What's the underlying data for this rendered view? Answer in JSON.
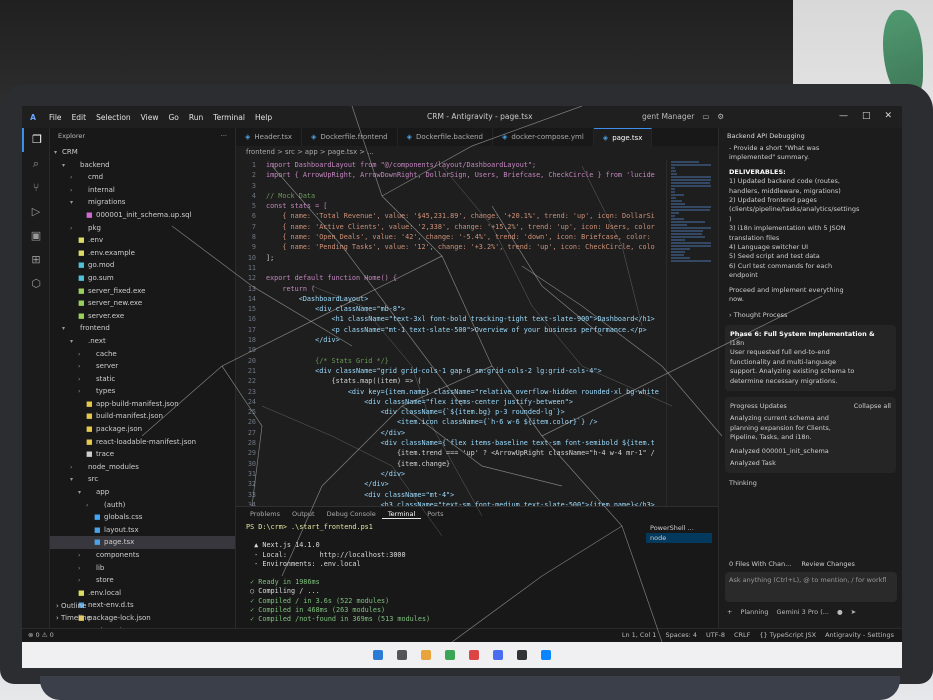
{
  "window": {
    "menu": [
      "File",
      "Edit",
      "Selection",
      "View",
      "Go",
      "Run",
      "Terminal",
      "Help"
    ],
    "title": "CRM - Antigravity - page.tsx",
    "agent_manager": "gent Manager"
  },
  "explorer": {
    "header": "Explorer",
    "root": "CRM",
    "items": [
      {
        "label": "backend",
        "type": "folder",
        "depth": 1,
        "open": true
      },
      {
        "label": "cmd",
        "type": "folder",
        "depth": 2
      },
      {
        "label": "internal",
        "type": "folder",
        "depth": 2
      },
      {
        "label": "migrations",
        "type": "folder",
        "depth": 2,
        "open": true
      },
      {
        "label": "000001_init_schema.up.sql",
        "type": "sql",
        "depth": 3
      },
      {
        "label": "pkg",
        "type": "folder",
        "depth": 2
      },
      {
        "label": ".env",
        "type": "env",
        "depth": 2
      },
      {
        "label": ".env.example",
        "type": "env",
        "depth": 2
      },
      {
        "label": "go.mod",
        "type": "go",
        "depth": 2
      },
      {
        "label": "go.sum",
        "type": "go",
        "depth": 2
      },
      {
        "label": "server_fixed.exe",
        "type": "exe",
        "depth": 2
      },
      {
        "label": "server_new.exe",
        "type": "exe",
        "depth": 2
      },
      {
        "label": "server.exe",
        "type": "exe",
        "depth": 2
      },
      {
        "label": "frontend",
        "type": "folder",
        "depth": 1,
        "open": true
      },
      {
        "label": ".next",
        "type": "folder",
        "depth": 2,
        "open": true
      },
      {
        "label": "cache",
        "type": "folder",
        "depth": 3
      },
      {
        "label": "server",
        "type": "folder",
        "depth": 3
      },
      {
        "label": "static",
        "type": "folder",
        "depth": 3
      },
      {
        "label": "types",
        "type": "folder",
        "depth": 3
      },
      {
        "label": "app-build-manifest.json",
        "type": "json",
        "depth": 3
      },
      {
        "label": "build-manifest.json",
        "type": "json",
        "depth": 3
      },
      {
        "label": "package.json",
        "type": "json",
        "depth": 3
      },
      {
        "label": "react-loadable-manifest.json",
        "type": "json",
        "depth": 3
      },
      {
        "label": "trace",
        "type": "file",
        "depth": 3
      },
      {
        "label": "node_modules",
        "type": "folder",
        "depth": 2
      },
      {
        "label": "src",
        "type": "folder",
        "depth": 2,
        "open": true
      },
      {
        "label": "app",
        "type": "folder",
        "depth": 3,
        "open": true
      },
      {
        "label": "(auth)",
        "type": "folder",
        "depth": 4
      },
      {
        "label": "globals.css",
        "type": "css",
        "depth": 4
      },
      {
        "label": "layout.tsx",
        "type": "ts",
        "depth": 4
      },
      {
        "label": "page.tsx",
        "type": "ts",
        "depth": 4,
        "selected": true
      },
      {
        "label": "components",
        "type": "folder",
        "depth": 3
      },
      {
        "label": "lib",
        "type": "folder",
        "depth": 3
      },
      {
        "label": "store",
        "type": "folder",
        "depth": 3
      },
      {
        "label": ".env.local",
        "type": "env",
        "depth": 2
      },
      {
        "label": "next-env.d.ts",
        "type": "ts",
        "depth": 2
      },
      {
        "label": "package-lock.json",
        "type": "json",
        "depth": 2
      },
      {
        "label": "package.json",
        "type": "json",
        "depth": 2
      }
    ],
    "outline": "Outline",
    "timeline": "Timeline"
  },
  "tabs": [
    {
      "label": "Header.tsx",
      "active": false
    },
    {
      "label": "Dockerfile.frontend",
      "active": false
    },
    {
      "label": "Dockerfile.backend",
      "active": false
    },
    {
      "label": "docker-compose.yml",
      "active": false
    },
    {
      "label": "page.tsx",
      "active": true
    }
  ],
  "breadcrumb": "frontend > src > app > page.tsx > ...",
  "code_lines": [
    {
      "n": "1",
      "t": "import DashboardLayout from \"@/components/layout/DashboardLayout\";"
    },
    {
      "n": "2",
      "t": "import { ArrowUpRight, ArrowDownRight, DollarSign, Users, Briefcase, CheckCircle } from 'lucide"
    },
    {
      "n": "3",
      "t": ""
    },
    {
      "n": "4",
      "t": "// Mock Data"
    },
    {
      "n": "5",
      "t": "const stats = ["
    },
    {
      "n": "6",
      "t": "    { name: 'Total Revenue', value: '$45,231.89', change: '+20.1%', trend: 'up', icon: DollarSi"
    },
    {
      "n": "7",
      "t": "    { name: 'Active Clients', value: '2,338', change: '+15.2%', trend: 'up', icon: Users, color"
    },
    {
      "n": "8",
      "t": "    { name: 'Open Deals', value: '42', change: '-5.4%', trend: 'down', icon: Briefcase, color:"
    },
    {
      "n": "9",
      "t": "    { name: 'Pending Tasks', value: '12', change: '+3.2%', trend: 'up', icon: CheckCircle, colo"
    },
    {
      "n": "10",
      "t": "];"
    },
    {
      "n": "11",
      "t": ""
    },
    {
      "n": "12",
      "t": "export default function Home() {"
    },
    {
      "n": "13",
      "t": "    return ("
    },
    {
      "n": "14",
      "t": "        <DashboardLayout>"
    },
    {
      "n": "15",
      "t": "            <div className=\"mb-8\">"
    },
    {
      "n": "16",
      "t": "                <h1 className=\"text-3xl font-bold tracking-tight text-slate-900\">Dashboard</h1>"
    },
    {
      "n": "17",
      "t": "                <p className=\"mt-1 text-slate-500\">Overview of your business performance.</p>"
    },
    {
      "n": "18",
      "t": "            </div>"
    },
    {
      "n": "19",
      "t": ""
    },
    {
      "n": "20",
      "t": "            {/* Stats Grid */}"
    },
    {
      "n": "21",
      "t": "            <div className=\"grid grid-cols-1 gap-6 sm:grid-cols-2 lg:grid-cols-4\">"
    },
    {
      "n": "22",
      "t": "                {stats.map((item) => ("
    },
    {
      "n": "23",
      "t": "                    <div key={item.name} className=\"relative overflow-hidden rounded-xl bg-white"
    },
    {
      "n": "24",
      "t": "                        <div className=\"flex items-center justify-between\">"
    },
    {
      "n": "25",
      "t": "                            <div className={`${item.bg} p-3 rounded-lg`}>"
    },
    {
      "n": "26",
      "t": "                                <item.icon className={`h-6 w-6 ${item.color}`} />"
    },
    {
      "n": "27",
      "t": "                            </div>"
    },
    {
      "n": "28",
      "t": "                            <div className={`flex items-baseline text-sm font-semibold ${item.t"
    },
    {
      "n": "29",
      "t": "                                {item.trend === 'up' ? <ArrowUpRight className=\"h-4 w-4 mr-1\" /"
    },
    {
      "n": "30",
      "t": "                                {item.change}"
    },
    {
      "n": "31",
      "t": "                            </div>"
    },
    {
      "n": "32",
      "t": "                        </div>"
    },
    {
      "n": "33",
      "t": "                        <div className=\"mt-4\">"
    },
    {
      "n": "34",
      "t": "                            <h3 className=\"text-sm font-medium text-slate-500\">{item.name}</h3>"
    }
  ],
  "panel": {
    "tabs": [
      "Problems",
      "Output",
      "Debug Console",
      "Terminal",
      "Ports"
    ],
    "active_tab": "Terminal",
    "terminal_lines": [
      "PS D:\\crm> .\\start_frontend.ps1",
      "",
      "  ▲ Next.js 14.1.0",
      "  - Local:        http://localhost:3000",
      "  - Environments: .env.local",
      "",
      " ✓ Ready in 1986ms",
      " ○ Compiling / ...",
      " ✓ Compiled / in 3.6s (522 modules)",
      " ✓ Compiled in 468ms (263 modules)",
      " ✓ Compiled /not-found in 369ms (513 modules)"
    ],
    "terminals": [
      "PowerShell ...",
      "node"
    ]
  },
  "chat": {
    "title": "Backend API Debugging",
    "lines": [
      "- Provide a short \"What was",
      "implemented\" summary.",
      "",
      "DELIVERABLES:",
      "1) Updated backend code (routes,",
      "handlers, middleware, migrations)",
      "2) Updated frontend pages",
      "(clients/pipeline/tasks/analytics/settings",
      ")",
      "3) i18n implementation with 5 JSON",
      "translation files",
      "4) Language switcher UI",
      "5) Seed script and test data",
      "6) Curl test commands for each",
      "endpoint",
      "",
      "Proceed and implement everything",
      "now."
    ],
    "thought": "Thought Process",
    "phase_title": "Phase 6: Full System Implementation &",
    "phase_lines": [
      "i18n",
      "User requested full end-to-end",
      "functionality and multi-language",
      "support. Analyzing existing schema to",
      "determine necessary migrations."
    ],
    "progress_label": "Progress Updates",
    "collapse_label": "Collapse all",
    "progress_lines": [
      "Analyzing current schema and",
      "planning expansion for Clients,",
      "Pipeline, Tasks, and i18n."
    ],
    "analyzed_1": "Analyzed  000001_init_schema",
    "analyzed_2": "Analyzed  Task",
    "thinking": "Thinking",
    "files_changed": "0 Files With Chan...",
    "review": "Review Changes",
    "input_placeholder": "Ask anything (Ctrl+L), @ to mention, / for workfl",
    "mode": "Planning",
    "model": "Gemini 3 Pro (..."
  },
  "statusbar": {
    "left": [
      "⊗ 0  ⚠ 0"
    ],
    "right": [
      "Ln 1, Col 1",
      "Spaces: 4",
      "UTF-8",
      "CRLF",
      "{} TypeScript JSX",
      "Antigravity - Settings"
    ]
  },
  "colors": {
    "accent": "#3b8eea",
    "editor_bg": "#1e1e1e",
    "sidebar_bg": "#181818"
  }
}
